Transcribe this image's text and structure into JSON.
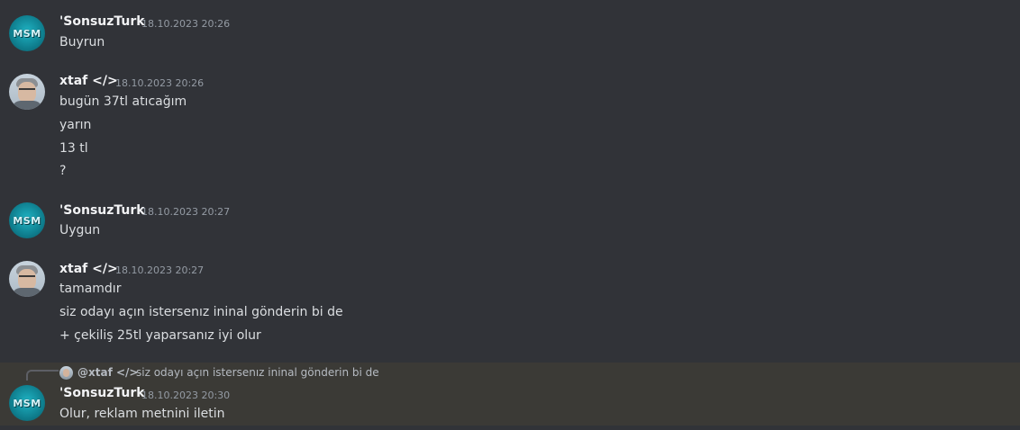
{
  "messages": [
    {
      "author": "'SonsuzTurk",
      "timestamp": "18.10.2023 20:26",
      "avatar": "msm-logo",
      "avatar_text": "MSM",
      "lines": [
        "Buyrun"
      ]
    },
    {
      "author": "xtaf </>",
      "timestamp": "18.10.2023 20:26",
      "avatar": "user-photo",
      "lines": [
        "bugün 37tl atıcağım",
        "yarın",
        "13 tl",
        "?"
      ]
    },
    {
      "author": "'SonsuzTurk",
      "timestamp": "18.10.2023 20:27",
      "avatar": "msm-logo",
      "avatar_text": "MSM",
      "lines": [
        "Uygun"
      ]
    },
    {
      "author": "xtaf </>",
      "timestamp": "18.10.2023 20:27",
      "avatar": "user-photo",
      "lines": [
        "tamamdır",
        "siz odayı açın istersenız ininal gönderin bi de",
        "+ çekiliş 25tl yaparsanız iyi olur"
      ]
    },
    {
      "author": "'SonsuzTurk",
      "timestamp": "18.10.2023 20:30",
      "avatar": "msm-logo",
      "avatar_text": "MSM",
      "highlighted": true,
      "reply": {
        "author": "@xtaf </>",
        "text": "siz odayı açın istersenız ininal gönderin bi de"
      },
      "lines": [
        "Olur, reklam metnini iletin"
      ]
    }
  ],
  "colors": {
    "background": "#313338",
    "highlight": "#3b3a36",
    "username": "#f2f3f5",
    "timestamp": "#949ba4",
    "text": "#dbdee1"
  }
}
